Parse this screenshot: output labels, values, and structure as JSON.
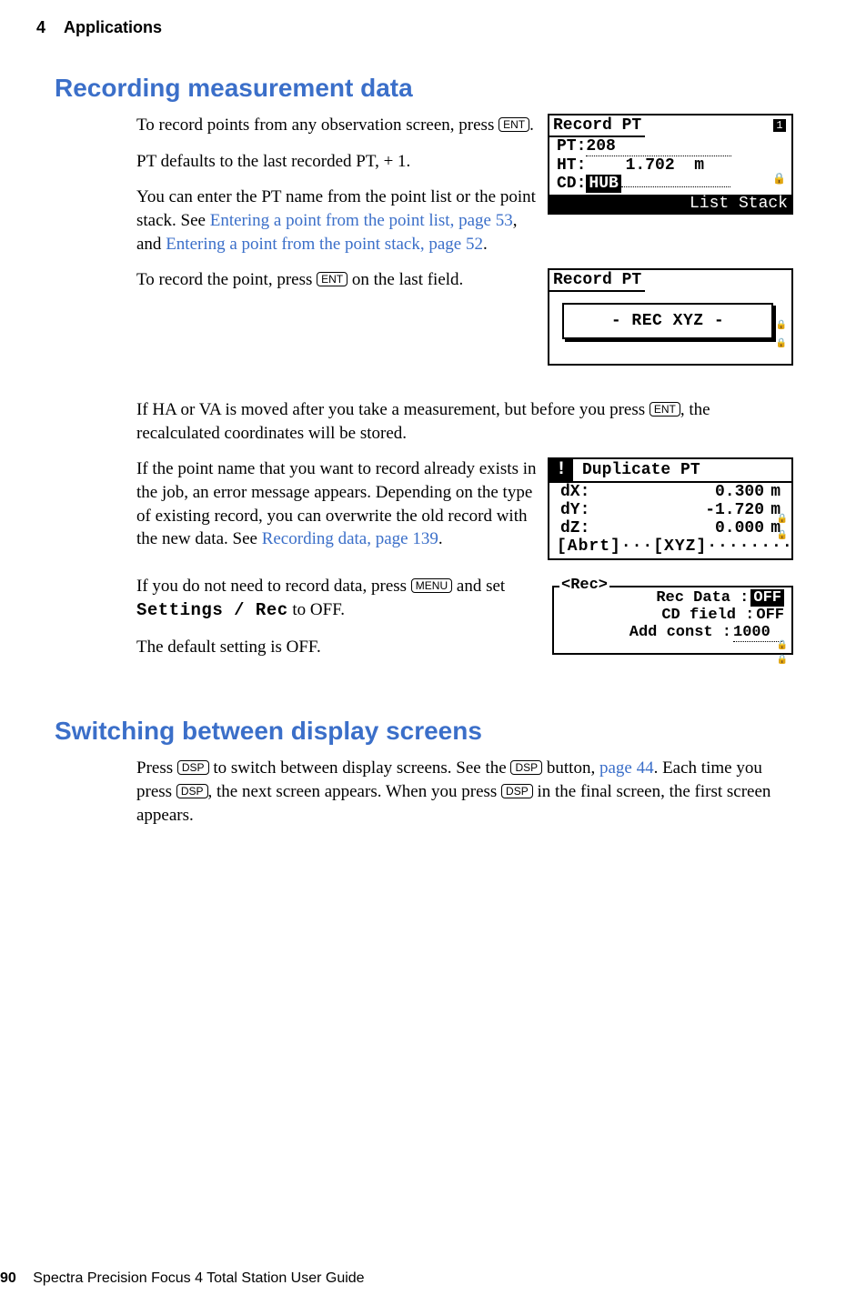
{
  "header": {
    "chapter_num": "4",
    "chapter_title": "Applications"
  },
  "section1": {
    "title": "Recording measurement data",
    "p1a": "To record points from any observation screen, press ",
    "p1b": ".",
    "p2": "PT defaults to the last recorded PT, + 1.",
    "p3a": "You can enter the PT name from the point list or the point stack. See ",
    "p3_link1": "Entering a point from the point list, page 53",
    "p3b": ", and ",
    "p3_link2": "Entering a point from the point stack, page 52",
    "p3c": ".",
    "p4a": "To record the point, press ",
    "p4b": " on the last field.",
    "p5a": "If HA or VA is moved after you take a measurement, but before you press ",
    "p5b": ", the recalculated coordinates will be stored.",
    "p6a": "If the point name that you want to record already exists in the job, an error message appears. Depending on the type of existing record, you can overwrite the old record with the new data. See ",
    "p6_link": "Recording data, page 139",
    "p6b": ".",
    "p7a": "If you do not need to record data, press ",
    "p7b": " and set ",
    "p7_cmd": "Settings / Rec",
    "p7c": " to OFF.",
    "p8": "The default setting is OFF."
  },
  "keys": {
    "ent": "ENT",
    "menu": "MENU",
    "dsp": "DSP"
  },
  "section2": {
    "title": "Switching between display screens",
    "p1a": "Press ",
    "p1b": " to switch between display screens. See the ",
    "p1c": " button, ",
    "p1_link": "page 44",
    "p1d": ". Each time you press ",
    "p1e": ", the next screen appears. When you press ",
    "p1f": " in the final screen, the first screen appears."
  },
  "scr1": {
    "title": "Record PT",
    "pt_label": "PT:",
    "pt_value": "208",
    "ht_label": "HT:",
    "ht_value": "1.702",
    "ht_unit": "m",
    "cd_label": "CD:",
    "cd_value": "HUB",
    "foot": "List Stack",
    "badge": "1"
  },
  "scr2": {
    "title": "Record PT",
    "inner": "- REC XYZ -"
  },
  "scr3": {
    "title": "Duplicate PT",
    "excl": "!",
    "rows": [
      {
        "label": "dX:",
        "value": "0.300",
        "unit": "m"
      },
      {
        "label": "dY:",
        "value": "-1.720",
        "unit": "m"
      },
      {
        "label": "dZ:",
        "value": "0.000",
        "unit": "m"
      }
    ],
    "foot": "[Abrt]···[XYZ]····················"
  },
  "scr4": {
    "title": "<Rec>",
    "rows": [
      {
        "label": "Rec Data :",
        "value": "OFF",
        "hl": true
      },
      {
        "label": "CD field :",
        "value": "OFF",
        "hl": false
      },
      {
        "label": "Add const :",
        "value": "1000",
        "hl": false,
        "dotted": true
      }
    ]
  },
  "footer": {
    "page": "90",
    "guide": "Spectra Precision Focus 4 Total Station User Guide"
  }
}
